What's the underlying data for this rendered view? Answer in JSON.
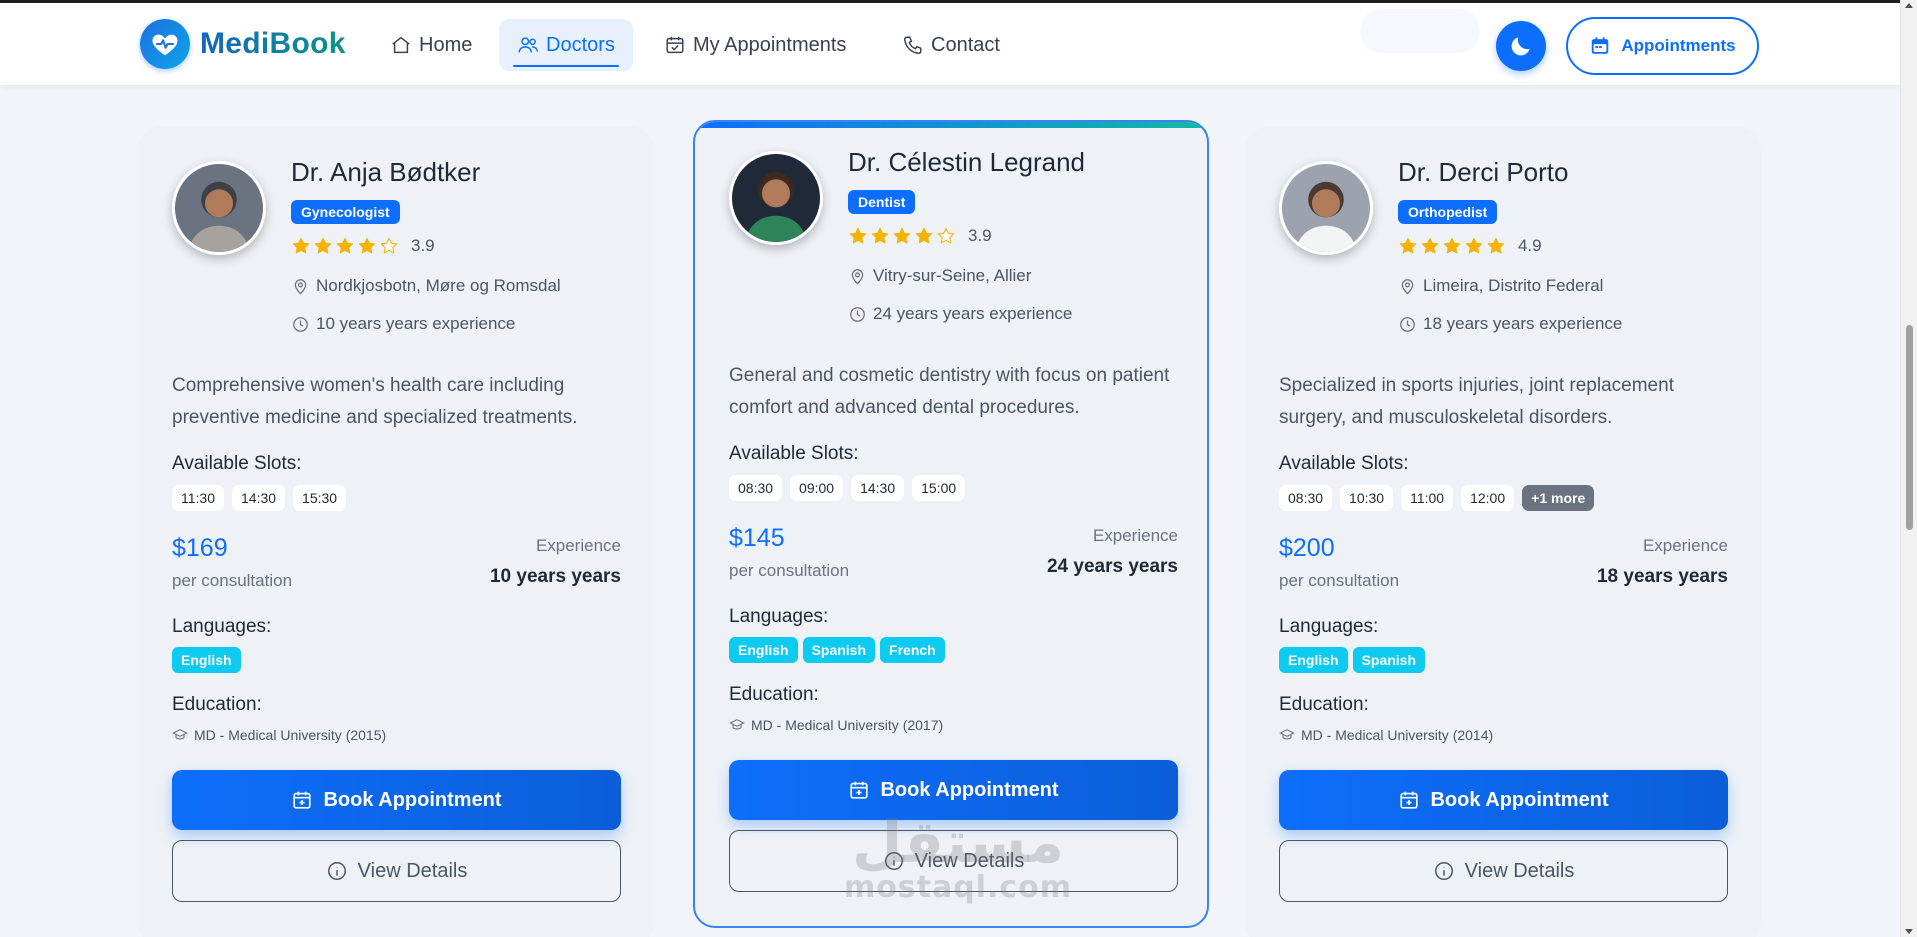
{
  "brand": {
    "name": "MediBook"
  },
  "nav": {
    "home": "Home",
    "doctors": "Doctors",
    "my_appointments": "My Appointments",
    "contact": "Contact",
    "appointments_button": "Appointments"
  },
  "colors": {
    "primary": "#0d6efd",
    "info": "#0dcaf0",
    "star": "#f5b301"
  },
  "labels": {
    "available_slots": "Available Slots:",
    "per_consultation": "per consultation",
    "experience": "Experience",
    "languages": "Languages:",
    "education": "Education:",
    "book": "Book Appointment",
    "details": "View Details"
  },
  "doctors": [
    {
      "name": "Dr. Anja Bødtker",
      "specialty": "Gynecologist",
      "rating": 3.9,
      "rating_text": "3.9",
      "location": "Nordkjosbotn, Møre og Romsdal",
      "experience_line": "10 years years experience",
      "description": "Comprehensive women's health care including preventive medicine and specialized treatments.",
      "slots": [
        "11:30",
        "14:30",
        "15:30"
      ],
      "more_slots": "",
      "price": "$169",
      "experience_value": "10 years years",
      "languages": [
        "English"
      ],
      "education": "MD - Medical University (2015)"
    },
    {
      "name": "Dr. Célestin Legrand",
      "specialty": "Dentist",
      "rating": 3.9,
      "rating_text": "3.9",
      "location": "Vitry-sur-Seine, Allier",
      "experience_line": "24 years years experience",
      "description": "General and cosmetic dentistry with focus on patient comfort and advanced dental procedures.",
      "slots": [
        "08:30",
        "09:00",
        "14:30",
        "15:00"
      ],
      "more_slots": "",
      "price": "$145",
      "experience_value": "24 years years",
      "languages": [
        "English",
        "Spanish",
        "French"
      ],
      "education": "MD - Medical University (2017)"
    },
    {
      "name": "Dr. Derci Porto",
      "specialty": "Orthopedist",
      "rating": 4.9,
      "rating_text": "4.9",
      "location": "Limeira, Distrito Federal",
      "experience_line": "18 years years experience",
      "description": "Specialized in sports injuries, joint replacement surgery, and musculoskeletal disorders.",
      "slots": [
        "08:30",
        "10:30",
        "11:00",
        "12:00"
      ],
      "more_slots": "+1 more",
      "price": "$200",
      "experience_value": "18 years years",
      "languages": [
        "English",
        "Spanish"
      ],
      "education": "MD - Medical University (2014)"
    }
  ],
  "watermark": {
    "arabic": "مستقل",
    "latin": "mostaql.com"
  }
}
